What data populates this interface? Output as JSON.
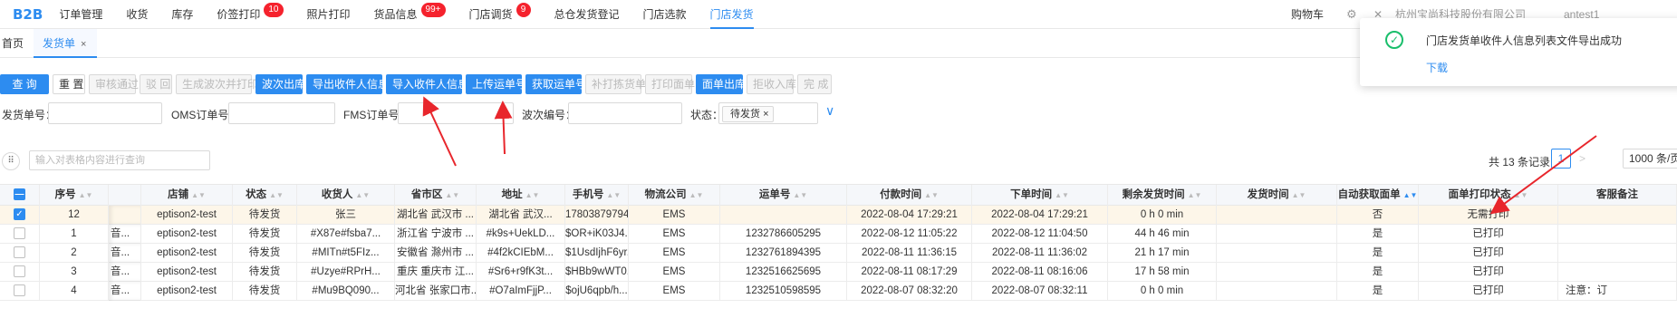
{
  "nav": {
    "brand": "B2B",
    "items": [
      {
        "label": "订单管理"
      },
      {
        "label": "收货"
      },
      {
        "label": "库存"
      },
      {
        "label": "价签打印",
        "badge": "10"
      },
      {
        "label": "照片打印"
      },
      {
        "label": "货品信息",
        "badge": "99+"
      },
      {
        "label": "门店调货",
        "badge": "9"
      },
      {
        "label": "总仓发货登记"
      },
      {
        "label": "门店选款"
      },
      {
        "label": "门店发货",
        "active": true
      }
    ],
    "cart": "购物车",
    "company": "杭州宝尚科技股份有限公司",
    "store": "antest1"
  },
  "tabs": {
    "home": "首页",
    "current": "发货单",
    "close": "×"
  },
  "toolbar": {
    "buttons": [
      {
        "label": "查 询",
        "style": "primary"
      },
      {
        "label": "重 置",
        "style": "default"
      },
      {
        "label": "审核通过",
        "style": "disabled"
      },
      {
        "label": "驳 回",
        "style": "disabled"
      },
      {
        "label": "生成波次并打印",
        "style": "disabled"
      },
      {
        "label": "波次出库",
        "style": "primary"
      },
      {
        "label": "导出收件人信息",
        "style": "primary"
      },
      {
        "label": "导入收件人信息",
        "style": "primary"
      },
      {
        "label": "上传运单号",
        "style": "primary"
      },
      {
        "label": "获取运单号",
        "style": "primary"
      },
      {
        "label": "补打拣货单",
        "style": "disabled"
      },
      {
        "label": "打印面单",
        "style": "disabled"
      },
      {
        "label": "面单出库",
        "style": "primary"
      },
      {
        "label": "拒收入库",
        "style": "disabled"
      },
      {
        "label": "完 成",
        "style": "disabled"
      }
    ]
  },
  "filters": {
    "ship_no": "发货单号：",
    "oms_no": "OMS订单号：",
    "fms_no": "FMS订单号：",
    "wave_no": "波次编号：",
    "status": "状态：",
    "status_tag": "待发货",
    "status_tag_close": "×",
    "expand": "∨"
  },
  "table_toolbar": {
    "search_placeholder": "输入对表格内容进行查询",
    "total": "共 13 条记录",
    "prev": "<",
    "page": "1",
    "next": ">",
    "page_size": "1000 条/页"
  },
  "table": {
    "columns": [
      "序号",
      "",
      "店铺",
      "状态",
      "收货人",
      "省市区",
      "地址",
      "手机号",
      "物流公司",
      "运单号",
      "付款时间",
      "下单时间",
      "剩余发货时间",
      "发货时间",
      "自动获取面单",
      "面单打印状态",
      "客服备注"
    ],
    "rows": [
      {
        "checked": true,
        "selected": true,
        "cells": [
          "12",
          "",
          "eptison2-test",
          "待发货",
          "张三",
          "湖北省 武汉市 ...",
          "湖北省 武汉...",
          "17803879794",
          "EMS",
          "",
          "2022-08-04 17:29:21",
          "2022-08-04 17:29:21",
          "0 h 0 min",
          "",
          "否",
          "无需打印",
          ""
        ]
      },
      {
        "checked": false,
        "cells": [
          "1",
          "音...",
          "eptison2-test",
          "待发货",
          "#X87e#fsba7...",
          "浙江省 宁波市 ...",
          "#k9s+UekLD...",
          "$OR+iK03J4...",
          "EMS",
          "1232786605295",
          "2022-08-12 11:05:22",
          "2022-08-12 11:04:50",
          "44 h 46 min",
          "",
          "是",
          "已打印",
          ""
        ]
      },
      {
        "checked": false,
        "cells": [
          "2",
          "音...",
          "eptison2-test",
          "待发货",
          "#MITn#t5FIz...",
          "安徽省 滁州市 ...",
          "#4f2kCIEbM...",
          "$1UsdIjhF6yr...",
          "EMS",
          "1232761894395",
          "2022-08-11 11:36:15",
          "2022-08-11 11:36:02",
          "21 h 17 min",
          "",
          "是",
          "已打印",
          ""
        ]
      },
      {
        "checked": false,
        "cells": [
          "3",
          "音...",
          "eptison2-test",
          "待发货",
          "#Uzye#RPrH...",
          "重庆 重庆市 江...",
          "#Sr6+r9fK3t...",
          "$HBb9wWT0...",
          "EMS",
          "1232516625695",
          "2022-08-11 08:17:29",
          "2022-08-11 08:16:06",
          "17 h 58 min",
          "",
          "是",
          "已打印",
          ""
        ]
      },
      {
        "checked": false,
        "cells": [
          "4",
          "音...",
          "eptison2-test",
          "待发货",
          "#Mu9BQ090...",
          "河北省 张家口市...",
          "#O7aImFjjP...",
          "$ojU6qpb/h...",
          "EMS",
          "1232510598595",
          "2022-08-07 08:32:20",
          "2022-08-07 08:32:11",
          "0 h 0 min",
          "",
          "是",
          "已打印",
          "注意：订"
        ]
      }
    ]
  },
  "toast": {
    "message": "门店发货单收件人信息列表文件导出成功",
    "link": "下载"
  },
  "colors": {
    "accent": "#2d8cf0",
    "badge": "#f5222d",
    "success": "#19be6b",
    "annotation": "#e8262c"
  }
}
